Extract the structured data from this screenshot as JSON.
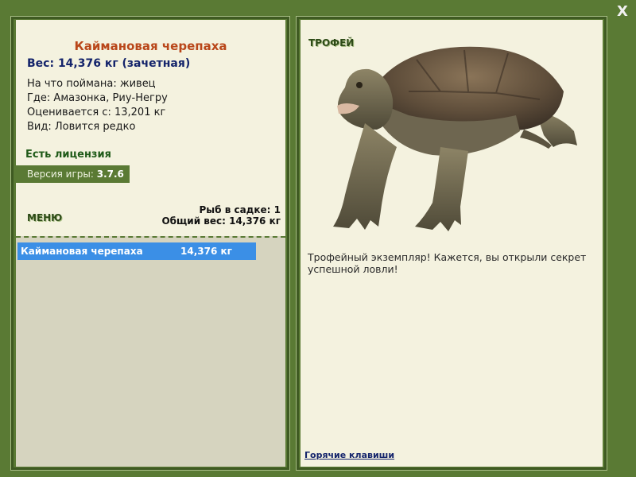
{
  "close_label": "X",
  "fish": {
    "title": "Каймановая черепаха",
    "weight_line": "Вес: 14,376 кг (зачетная)",
    "info": [
      "На что поймана: живец",
      "Где: Амазонка, Риу-Негру",
      "Оценивается с: 13,201 кг",
      "Вид: Ловится редко"
    ]
  },
  "license": "Есть лицензия",
  "version": {
    "label": "Версия игры: ",
    "value": "3.7.6"
  },
  "menu_label": "МЕНЮ",
  "net": {
    "count_line": "Рыб в садке: 1",
    "total_line": "Общий вес: 14,376 кг"
  },
  "fish_list": [
    {
      "name": "Каймановая черепаха",
      "weight": "14,376 кг"
    }
  ],
  "trophy": {
    "label": "ТРОФЕЙ",
    "description": "Трофейный экземпляр! Кажется, вы открыли секрет успешной ловли!",
    "image_icon": "snapping-turtle-icon"
  },
  "hotkeys_label": "Горячие клавиши",
  "colors": {
    "frame": "#5a7a34",
    "panel_bg": "#f4f2df",
    "list_bg": "#d6d4bf",
    "title": "#b9471a",
    "selected_row": "#3b8fe6"
  }
}
